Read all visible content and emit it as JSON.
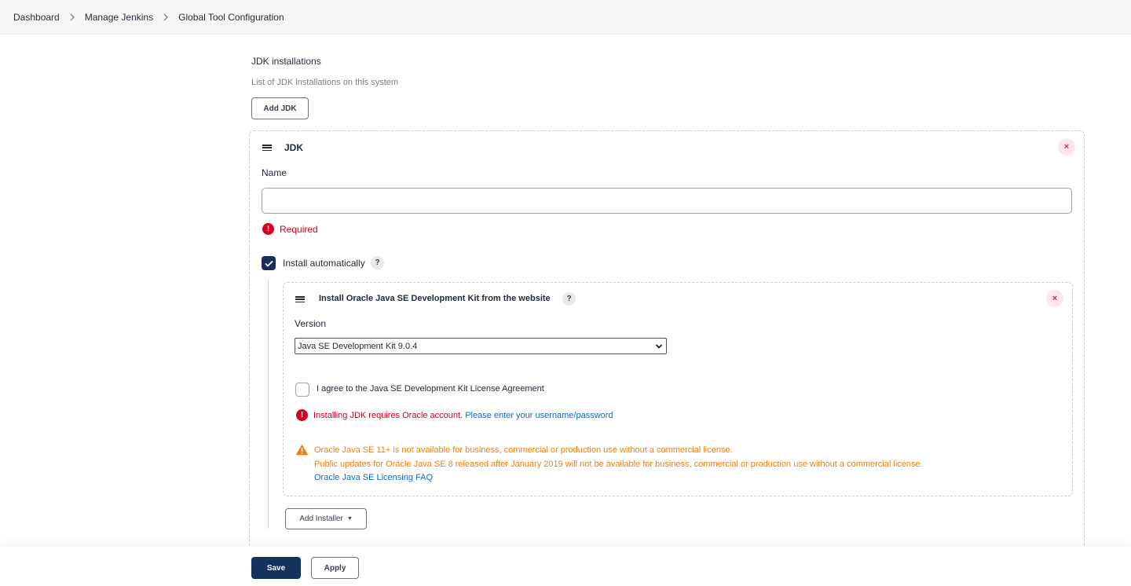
{
  "breadcrumb": {
    "items": [
      "Dashboard",
      "Manage Jenkins",
      "Global Tool Configuration"
    ]
  },
  "jdk_section": {
    "title": "JDK installations",
    "description": "List of JDK installations on this system",
    "add_button": "Add JDK"
  },
  "jdk_item": {
    "header": "JDK",
    "name_label": "Name",
    "name_value": "",
    "required_text": "Required",
    "install_auto_label": "Install automatically",
    "install_auto_checked": true,
    "help_glyph": "?",
    "close_glyph": "×"
  },
  "installer": {
    "title": "Install Oracle Java SE Development Kit from the website",
    "version_label": "Version",
    "version_selected": "Java SE Development Kit 9.0.4",
    "agree_label": "I agree to the Java SE Development Kit License Agreement",
    "agree_checked": false,
    "error_text": "Installing JDK requires Oracle account.",
    "error_link": "Please enter your username/password",
    "warning_line1": "Oracle Java SE 11+ is not available for business, commercial or production use without a commercial license.",
    "warning_line2": "Public updates for Oracle Java SE 8 released after January 2019 will not be available for business, commercial or production use without a commercial license.",
    "faq_link": "Oracle Java SE Licensing FAQ",
    "add_installer_button": "Add Installer"
  },
  "footer": {
    "save_button": "Save",
    "apply_button": "Apply"
  },
  "colors": {
    "primary": "#16325c",
    "error": "#d4001e",
    "warning": "#f07f0e",
    "link": "#1068d6"
  }
}
